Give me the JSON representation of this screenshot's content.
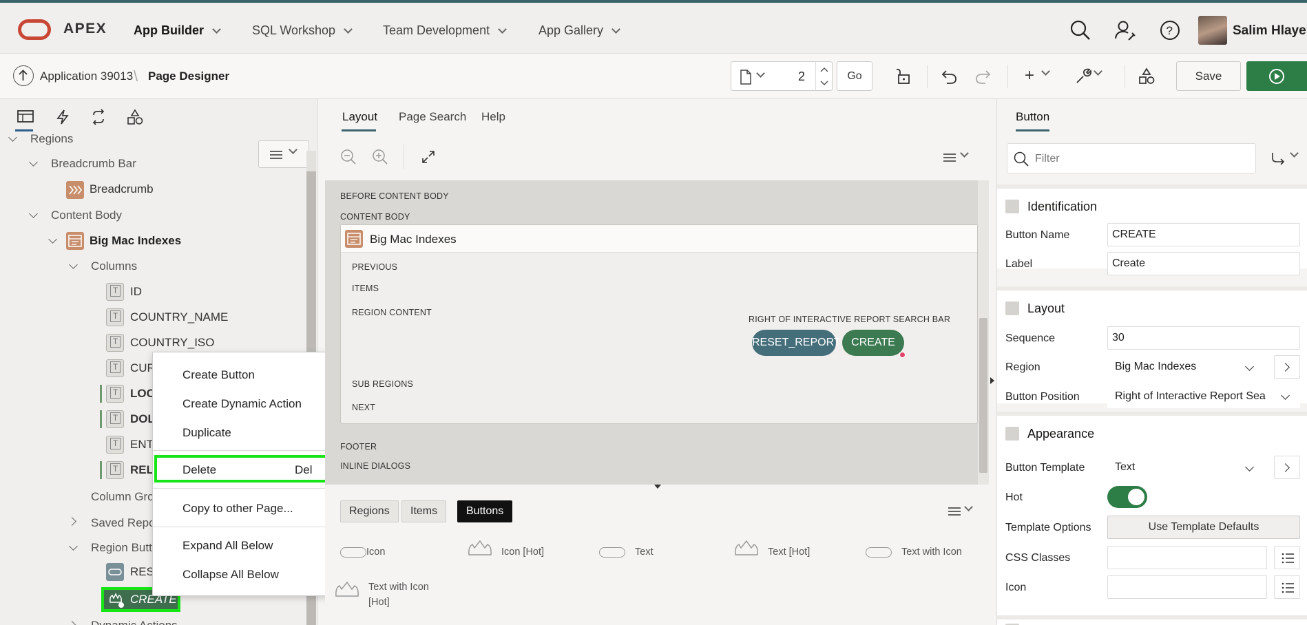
{
  "topnav": {
    "logo_text": "APEX",
    "items": [
      "App Builder",
      "SQL Workshop",
      "Team Development",
      "App Gallery"
    ],
    "user_name": "Salim Hlayel"
  },
  "toolbar": {
    "application": "Application 39013",
    "page_designer": "Page Designer",
    "page_number": "2",
    "go_label": "Go",
    "save_label": "Save"
  },
  "left_panel": {
    "tree": {
      "regions": "Regions",
      "breadcrumb_bar": "Breadcrumb Bar",
      "breadcrumb": "Breadcrumb",
      "content_body": "Content Body",
      "big_mac_indexes": "Big Mac Indexes",
      "columns": "Columns",
      "column_items": [
        "ID",
        "COUNTRY_NAME",
        "COUNTRY_ISO",
        "CURR",
        "LOCA",
        "DOLL",
        "ENTI",
        "RELA"
      ],
      "column_groups": "Column Grou",
      "saved_reports": "Saved Report",
      "region_buttons": "Region Butto",
      "reset_button": "RESE",
      "create_button": "CREATE",
      "dynamic_actions": "Dynamic Actions"
    }
  },
  "context_menu": {
    "create_button": "Create Button",
    "create_dynamic_action": "Create Dynamic Action",
    "duplicate": "Duplicate",
    "delete": "Delete",
    "delete_key": "Del",
    "copy_to_other_page": "Copy to other Page...",
    "expand_all_below": "Expand All Below",
    "collapse_all_below": "Collapse All Below"
  },
  "center": {
    "tabs": [
      "Layout",
      "Page Search",
      "Help"
    ],
    "canvas": {
      "before_content_body": "BEFORE CONTENT BODY",
      "content_body": "CONTENT BODY",
      "region_title": "Big Mac Indexes",
      "previous": "PREVIOUS",
      "items": "ITEMS",
      "region_content": "REGION CONTENT",
      "right_of_ir": "RIGHT OF INTERACTIVE REPORT SEARCH BAR",
      "reset_report": "RESET_REPORT",
      "create": "CREATE",
      "sub_regions": "SUB REGIONS",
      "next": "NEXT",
      "footer": "FOOTER",
      "inline_dialogs": "INLINE DIALOGS"
    },
    "gallery_tabs": [
      "Regions",
      "Items",
      "Buttons"
    ],
    "gallery_items": [
      "Icon",
      "Icon [Hot]",
      "Text",
      "Text [Hot]",
      "Text with Icon",
      "Text with Icon",
      "[Hot]"
    ]
  },
  "right_panel": {
    "tab": "Button",
    "filter_placeholder": "Filter",
    "identification": {
      "title": "Identification",
      "button_name_label": "Button Name",
      "button_name": "CREATE",
      "label_label": "Label",
      "label": "Create"
    },
    "layout": {
      "title": "Layout",
      "sequence_label": "Sequence",
      "sequence": "30",
      "region_label": "Region",
      "region": "Big Mac Indexes",
      "button_position_label": "Button Position",
      "button_position": "Right of Interactive Report Sea"
    },
    "appearance": {
      "title": "Appearance",
      "button_template_label": "Button Template",
      "button_template": "Text",
      "hot_label": "Hot",
      "template_options_label": "Template Options",
      "template_options_btn": "Use Template Defaults",
      "css_classes_label": "CSS Classes",
      "icon_label": "Icon"
    }
  },
  "colors": {
    "accent": "#3a6469",
    "oracle_red": "#c74634",
    "hot_green": "#2d7d46",
    "highlight_green": "#18e518",
    "reset_pill": "#456e7b"
  }
}
